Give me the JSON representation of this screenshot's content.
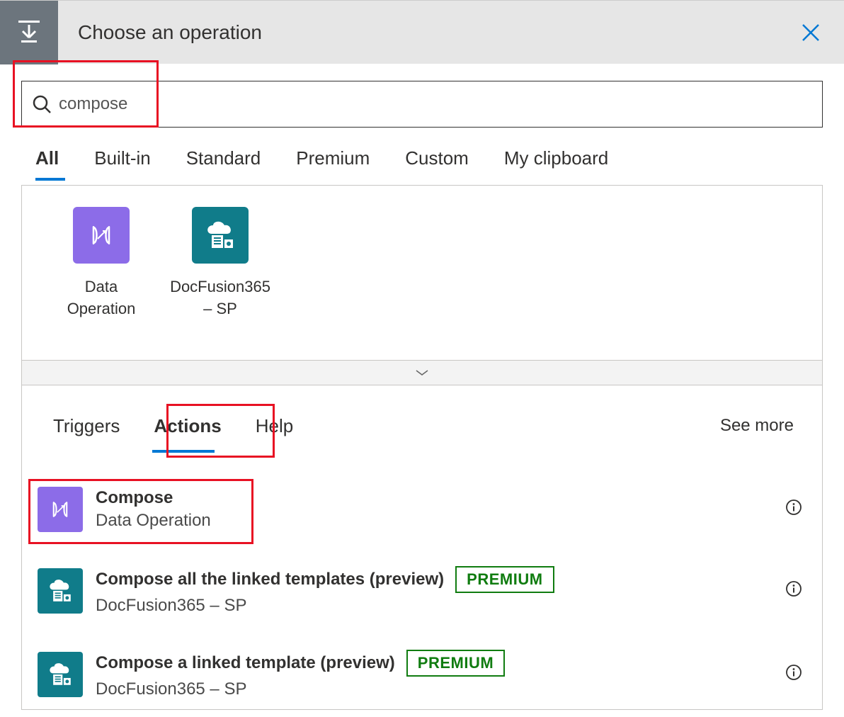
{
  "header": {
    "title": "Choose an operation"
  },
  "search": {
    "value": "compose"
  },
  "category_tabs": [
    "All",
    "Built-in",
    "Standard",
    "Premium",
    "Custom",
    "My clipboard"
  ],
  "connectors": [
    {
      "label": "Data Operation",
      "icon": "data-operation-icon",
      "color": "purple"
    },
    {
      "label": "DocFusion365 – SP",
      "icon": "docfusion-icon",
      "color": "teal"
    }
  ],
  "sub_tabs": [
    "Triggers",
    "Actions",
    "Help"
  ],
  "see_more": "See more",
  "actions": [
    {
      "title": "Compose",
      "subtitle": "Data Operation",
      "icon": "data-operation-icon",
      "color": "purple",
      "premium": false
    },
    {
      "title": "Compose all the linked templates (preview)",
      "subtitle": "DocFusion365 – SP",
      "icon": "docfusion-icon",
      "color": "teal",
      "premium": true
    },
    {
      "title": "Compose a linked template (preview)",
      "subtitle": "DocFusion365 – SP",
      "icon": "docfusion-icon",
      "color": "teal",
      "premium": true
    }
  ],
  "premium_label": "PREMIUM"
}
